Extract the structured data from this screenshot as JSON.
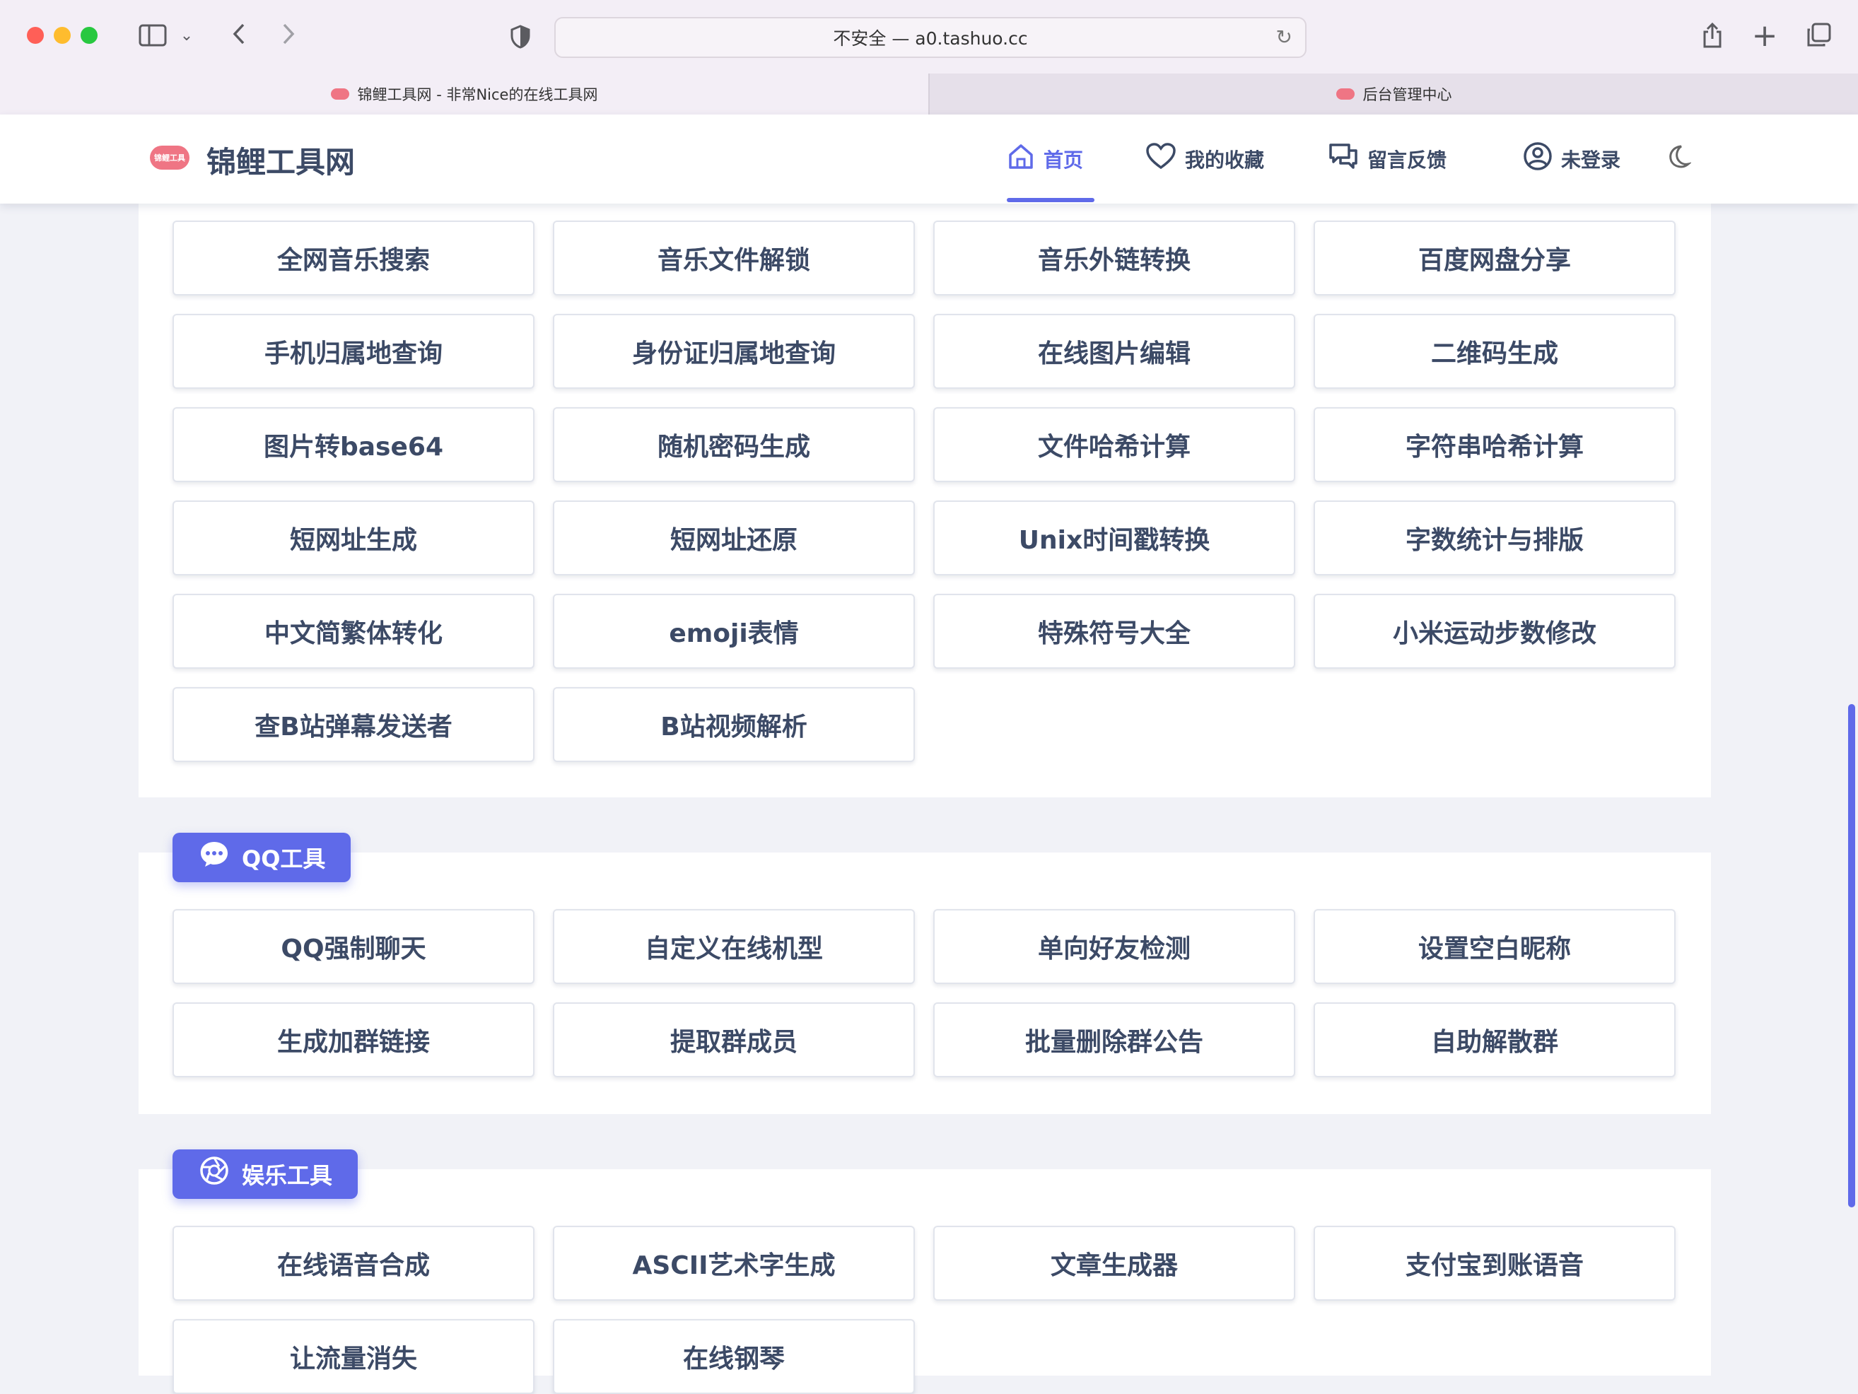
{
  "browser": {
    "url": "不安全 — a0.tashuo.cc",
    "tabs": [
      {
        "label": "锦鲤工具网 - 非常Nice的在线工具网"
      },
      {
        "label": "后台管理中心"
      }
    ]
  },
  "site": {
    "logo_text": "锦鲤工具网",
    "logo_mark": "锦鲤工具",
    "nav": [
      {
        "label": "首页",
        "icon": "home-icon"
      },
      {
        "label": "我的收藏",
        "icon": "heart-icon"
      },
      {
        "label": "留言反馈",
        "icon": "chat-icon"
      },
      {
        "label": "未登录",
        "icon": "user-icon"
      }
    ]
  },
  "sections": [
    {
      "title": "",
      "tools": [
        "全网音乐搜索",
        "音乐文件解锁",
        "音乐外链转换",
        "百度网盘分享",
        "手机归属地查询",
        "身份证归属地查询",
        "在线图片编辑",
        "二维码生成",
        "图片转base64",
        "随机密码生成",
        "文件哈希计算",
        "字符串哈希计算",
        "短网址生成",
        "短网址还原",
        "Unix时间戳转换",
        "字数统计与排版",
        "中文简繁体转化",
        "emoji表情",
        "特殊符号大全",
        "小米运动步数修改",
        "查B站弹幕发送者",
        "B站视频解析"
      ]
    },
    {
      "title": "QQ工具",
      "icon": "chat-bubble-icon",
      "tools": [
        "QQ强制聊天",
        "自定义在线机型",
        "单向好友检测",
        "设置空白昵称",
        "生成加群链接",
        "提取群成员",
        "批量删除群公告",
        "自助解散群"
      ]
    },
    {
      "title": "娱乐工具",
      "icon": "aperture-icon",
      "tools": [
        "在线语音合成",
        "ASCII艺术字生成",
        "文章生成器",
        "支付宝到账语音",
        "让流量消失",
        "在线钢琴"
      ]
    }
  ],
  "colors": {
    "accent": "#5f6ae9",
    "logo": "#ef7584",
    "page_bg": "#f1f2f7"
  }
}
